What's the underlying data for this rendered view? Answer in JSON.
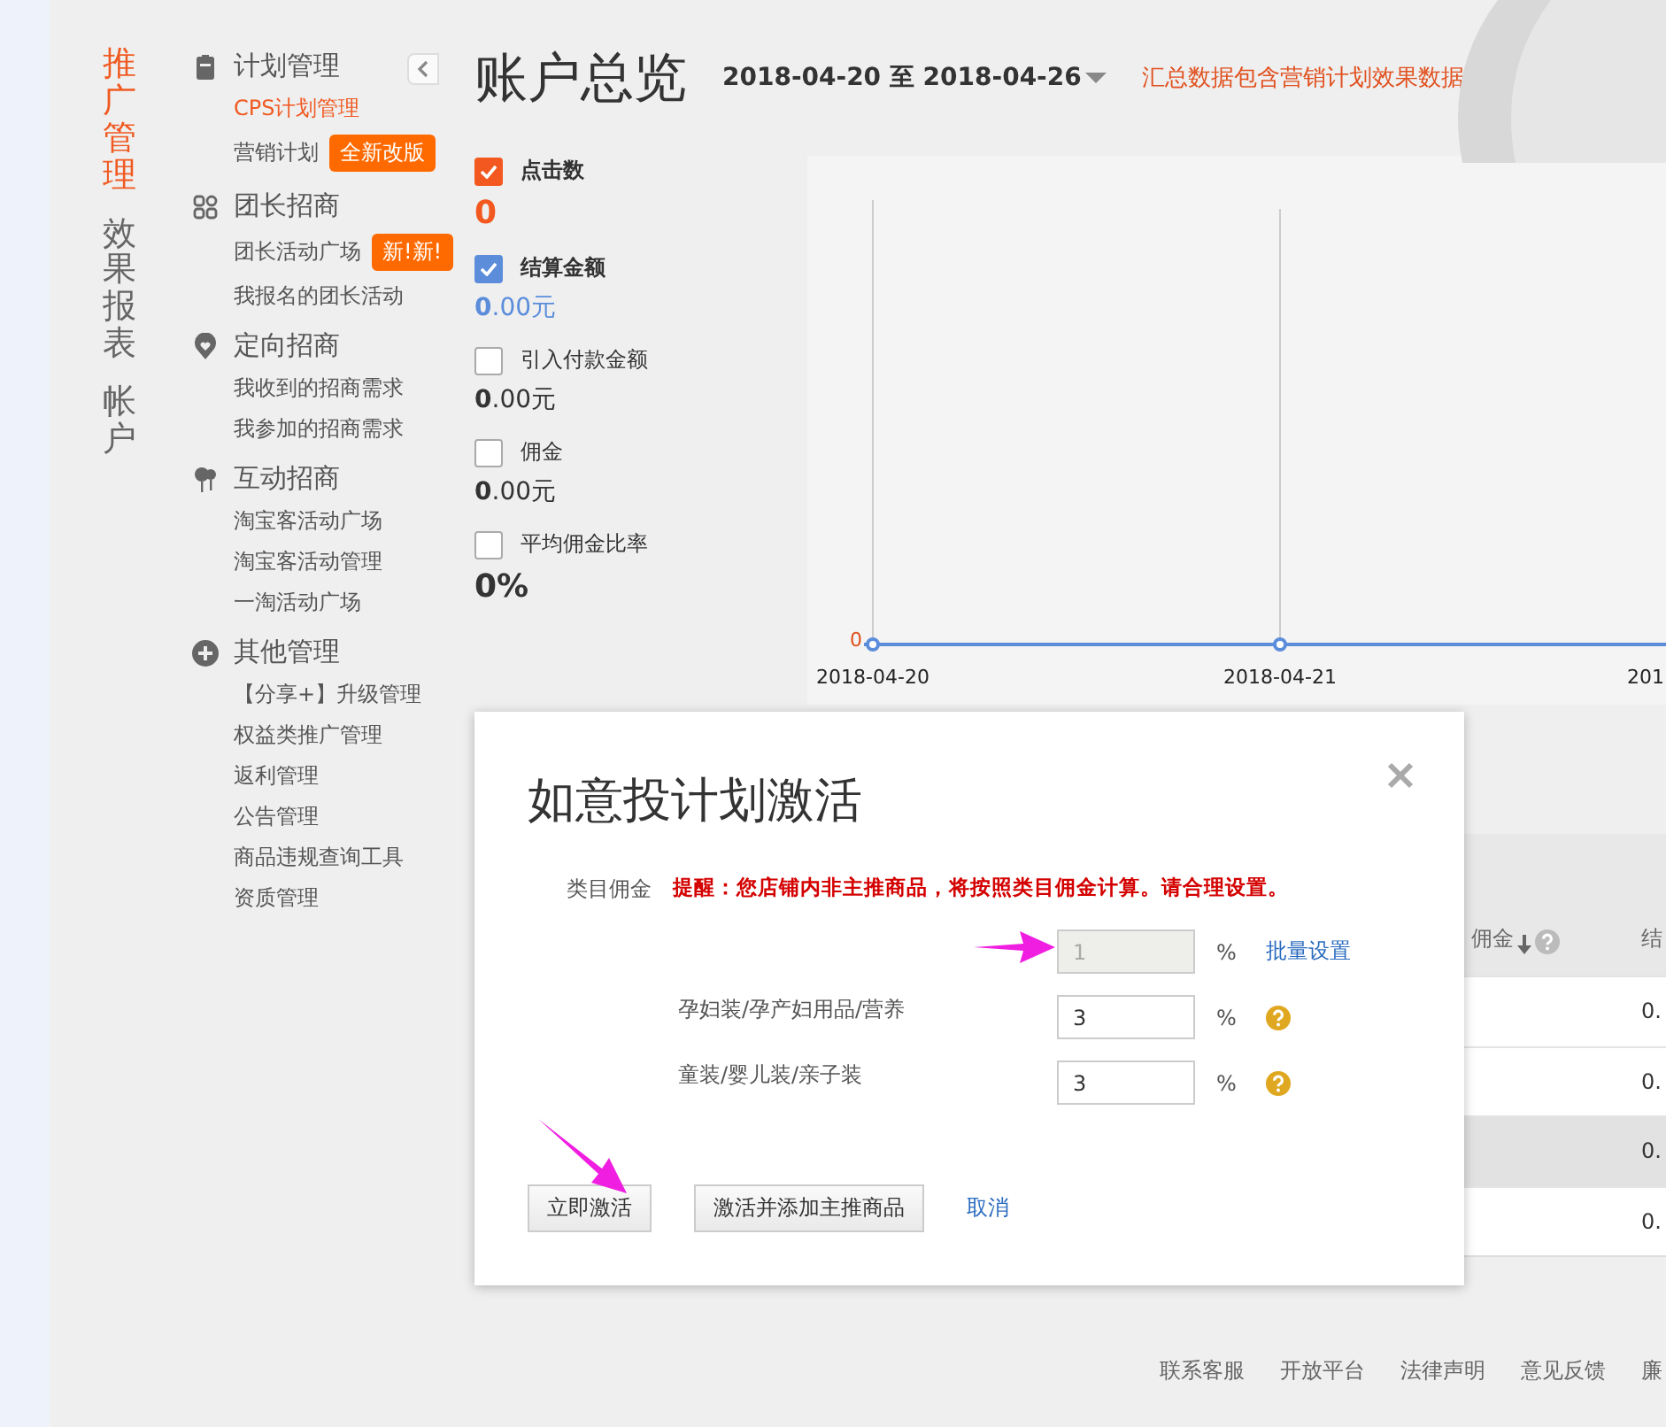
{
  "left_nav": [
    {
      "label": "推广管理",
      "selected": true
    },
    {
      "label": "效果报表",
      "selected": false
    },
    {
      "label": "帐户",
      "selected": false
    }
  ],
  "sidebar": {
    "groups": [
      {
        "title": "计划管理",
        "items": [
          {
            "label": "CPS计划管理",
            "selected": true
          },
          {
            "label": "营销计划",
            "selected": false,
            "badge": "全新改版"
          }
        ]
      },
      {
        "title": "团长招商",
        "items": [
          {
            "label": "团长活动广场",
            "selected": false,
            "badge": "新!新!"
          },
          {
            "label": "我报名的团长活动",
            "selected": false
          }
        ]
      },
      {
        "title": "定向招商",
        "items": [
          {
            "label": "我收到的招商需求",
            "selected": false
          },
          {
            "label": "我参加的招商需求",
            "selected": false
          }
        ]
      },
      {
        "title": "互动招商",
        "items": [
          {
            "label": "淘宝客活动广场",
            "selected": false
          },
          {
            "label": "淘宝客活动管理",
            "selected": false
          },
          {
            "label": "一淘活动广场",
            "selected": false
          }
        ]
      },
      {
        "title": "其他管理",
        "items": [
          {
            "label": "【分享+】升级管理",
            "selected": false
          },
          {
            "label": "权益类推广管理",
            "selected": false
          },
          {
            "label": "返利管理",
            "selected": false
          },
          {
            "label": "公告管理",
            "selected": false
          },
          {
            "label": "商品违规查询工具",
            "selected": false
          },
          {
            "label": "资质管理",
            "selected": false
          }
        ]
      }
    ]
  },
  "header": {
    "title": "账户总览",
    "date_range": "2018-04-20 至 2018-04-26",
    "note": "汇总数据包含营销计划效果数据"
  },
  "metrics": [
    {
      "label": "点击数",
      "checked": true,
      "color": "#f2581f",
      "value": "0",
      "bold": true
    },
    {
      "label": "结算金额",
      "checked": true,
      "color": "#5b8ddb",
      "value": "**0**.00元",
      "bold": false
    },
    {
      "label": "引入付款金额",
      "checked": false,
      "value": "**0**.00元",
      "bold": false
    },
    {
      "label": "佣金",
      "checked": false,
      "value": "**0**.00元",
      "bold": false
    },
    {
      "label": "平均佣金比率",
      "checked": false,
      "value": "0%",
      "bold": true
    }
  ],
  "chart": {
    "y_tick": "0",
    "x_labels": [
      "2018-04-20",
      "2018-04-21",
      "201"
    ]
  },
  "table": {
    "columns": [
      {
        "label": "佣金"
      },
      {
        "label": "结"
      }
    ],
    "rows": [
      {
        "cells": [
          "0."
        ],
        "selected": false
      },
      {
        "cells": [
          "0."
        ],
        "selected": false
      },
      {
        "cells": [
          "0."
        ],
        "selected": true
      },
      {
        "cells": [
          "0."
        ],
        "selected": false
      }
    ]
  },
  "dialog": {
    "title": "如意投计划激活",
    "category_label": "类目佣金",
    "warning": "提醒：您店铺内非主推商品，将按照类目佣金计算。请合理设置。",
    "rows": [
      {
        "kind": "batch",
        "value": "1",
        "disabled": true,
        "unit": "%",
        "link": "批量设置"
      },
      {
        "kind": "category",
        "label": "孕妇装/孕产妇用品/营养",
        "value": "3",
        "disabled": false,
        "unit": "%"
      },
      {
        "kind": "category",
        "label": "童装/婴儿装/亲子装",
        "value": "3",
        "disabled": false,
        "unit": "%"
      }
    ],
    "buttons": [
      {
        "kind": "button",
        "label": "立即激活"
      },
      {
        "kind": "button",
        "label": "激活并添加主推商品"
      },
      {
        "kind": "link",
        "label": "取消"
      }
    ]
  },
  "footer": {
    "links": [
      "联系客服",
      "开放平台",
      "法律声明",
      "意见反馈",
      "廉"
    ]
  }
}
